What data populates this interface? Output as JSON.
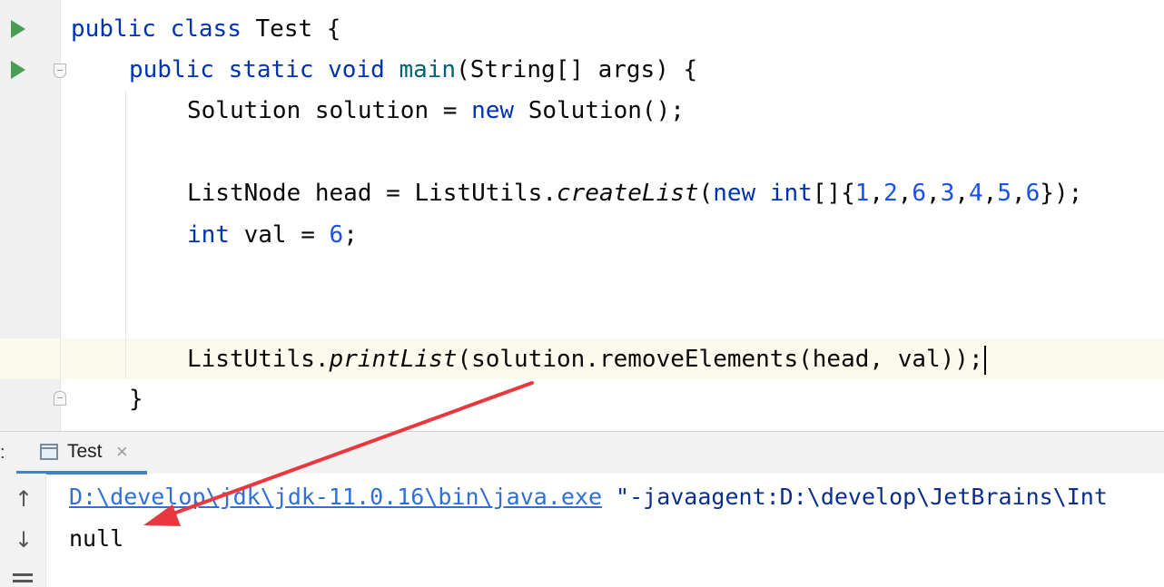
{
  "editor": {
    "lines": {
      "l1": {
        "kw1": "public",
        "kw2": "class",
        "rest": " Test {"
      },
      "l2": {
        "kw1": "public",
        "kw2": "static",
        "kw3": "void",
        "fn": "main",
        "rest": "(String[] args) {"
      },
      "l3": {
        "text1": "Solution solution = ",
        "kw": "new",
        "text2": " Solution();"
      },
      "l5": {
        "text1": "ListNode head = ListUtils.",
        "it": "createList",
        "p1": "(",
        "kw1": "new",
        "sp": " ",
        "kw2": "int",
        "p2": "[]{",
        "n1": "1",
        "c1": ",",
        "n2": "2",
        "c2": ",",
        "n3": "6",
        "c3": ",",
        "n4": "3",
        "c4": ",",
        "n5": "4",
        "c5": ",",
        "n6": "5",
        "c6": ",",
        "n7": "6",
        "end": "});"
      },
      "l6": {
        "kw": "int",
        "text1": " val = ",
        "num": "6",
        "end": ";"
      },
      "l9": {
        "text1": "ListUtils.",
        "it": "printList",
        "text2": "(solution.removeElements(head, val));"
      },
      "l10": {
        "text": "}"
      }
    }
  },
  "run_panel": {
    "prefix": ":",
    "tab_label": "Test",
    "tab_close": "×",
    "up_arrow": "↑",
    "down_arrow": "↓",
    "console": {
      "java_path": "D:\\develop\\jdk\\jdk-11.0.16\\bin\\java.exe",
      "args": " \"-javaagent:D:\\develop\\JetBrains\\Int",
      "output": "null"
    }
  },
  "colors": {
    "keyword": "#0033b3",
    "method": "#00627a",
    "number": "#1750eb",
    "annotation_arrow": "#e8383d",
    "run_icon": "#499c54"
  },
  "icons": [
    "run-icon",
    "fold-icon",
    "console-tab-icon",
    "close-icon",
    "up-arrow-icon",
    "down-arrow-icon",
    "soft-wrap-icon"
  ]
}
